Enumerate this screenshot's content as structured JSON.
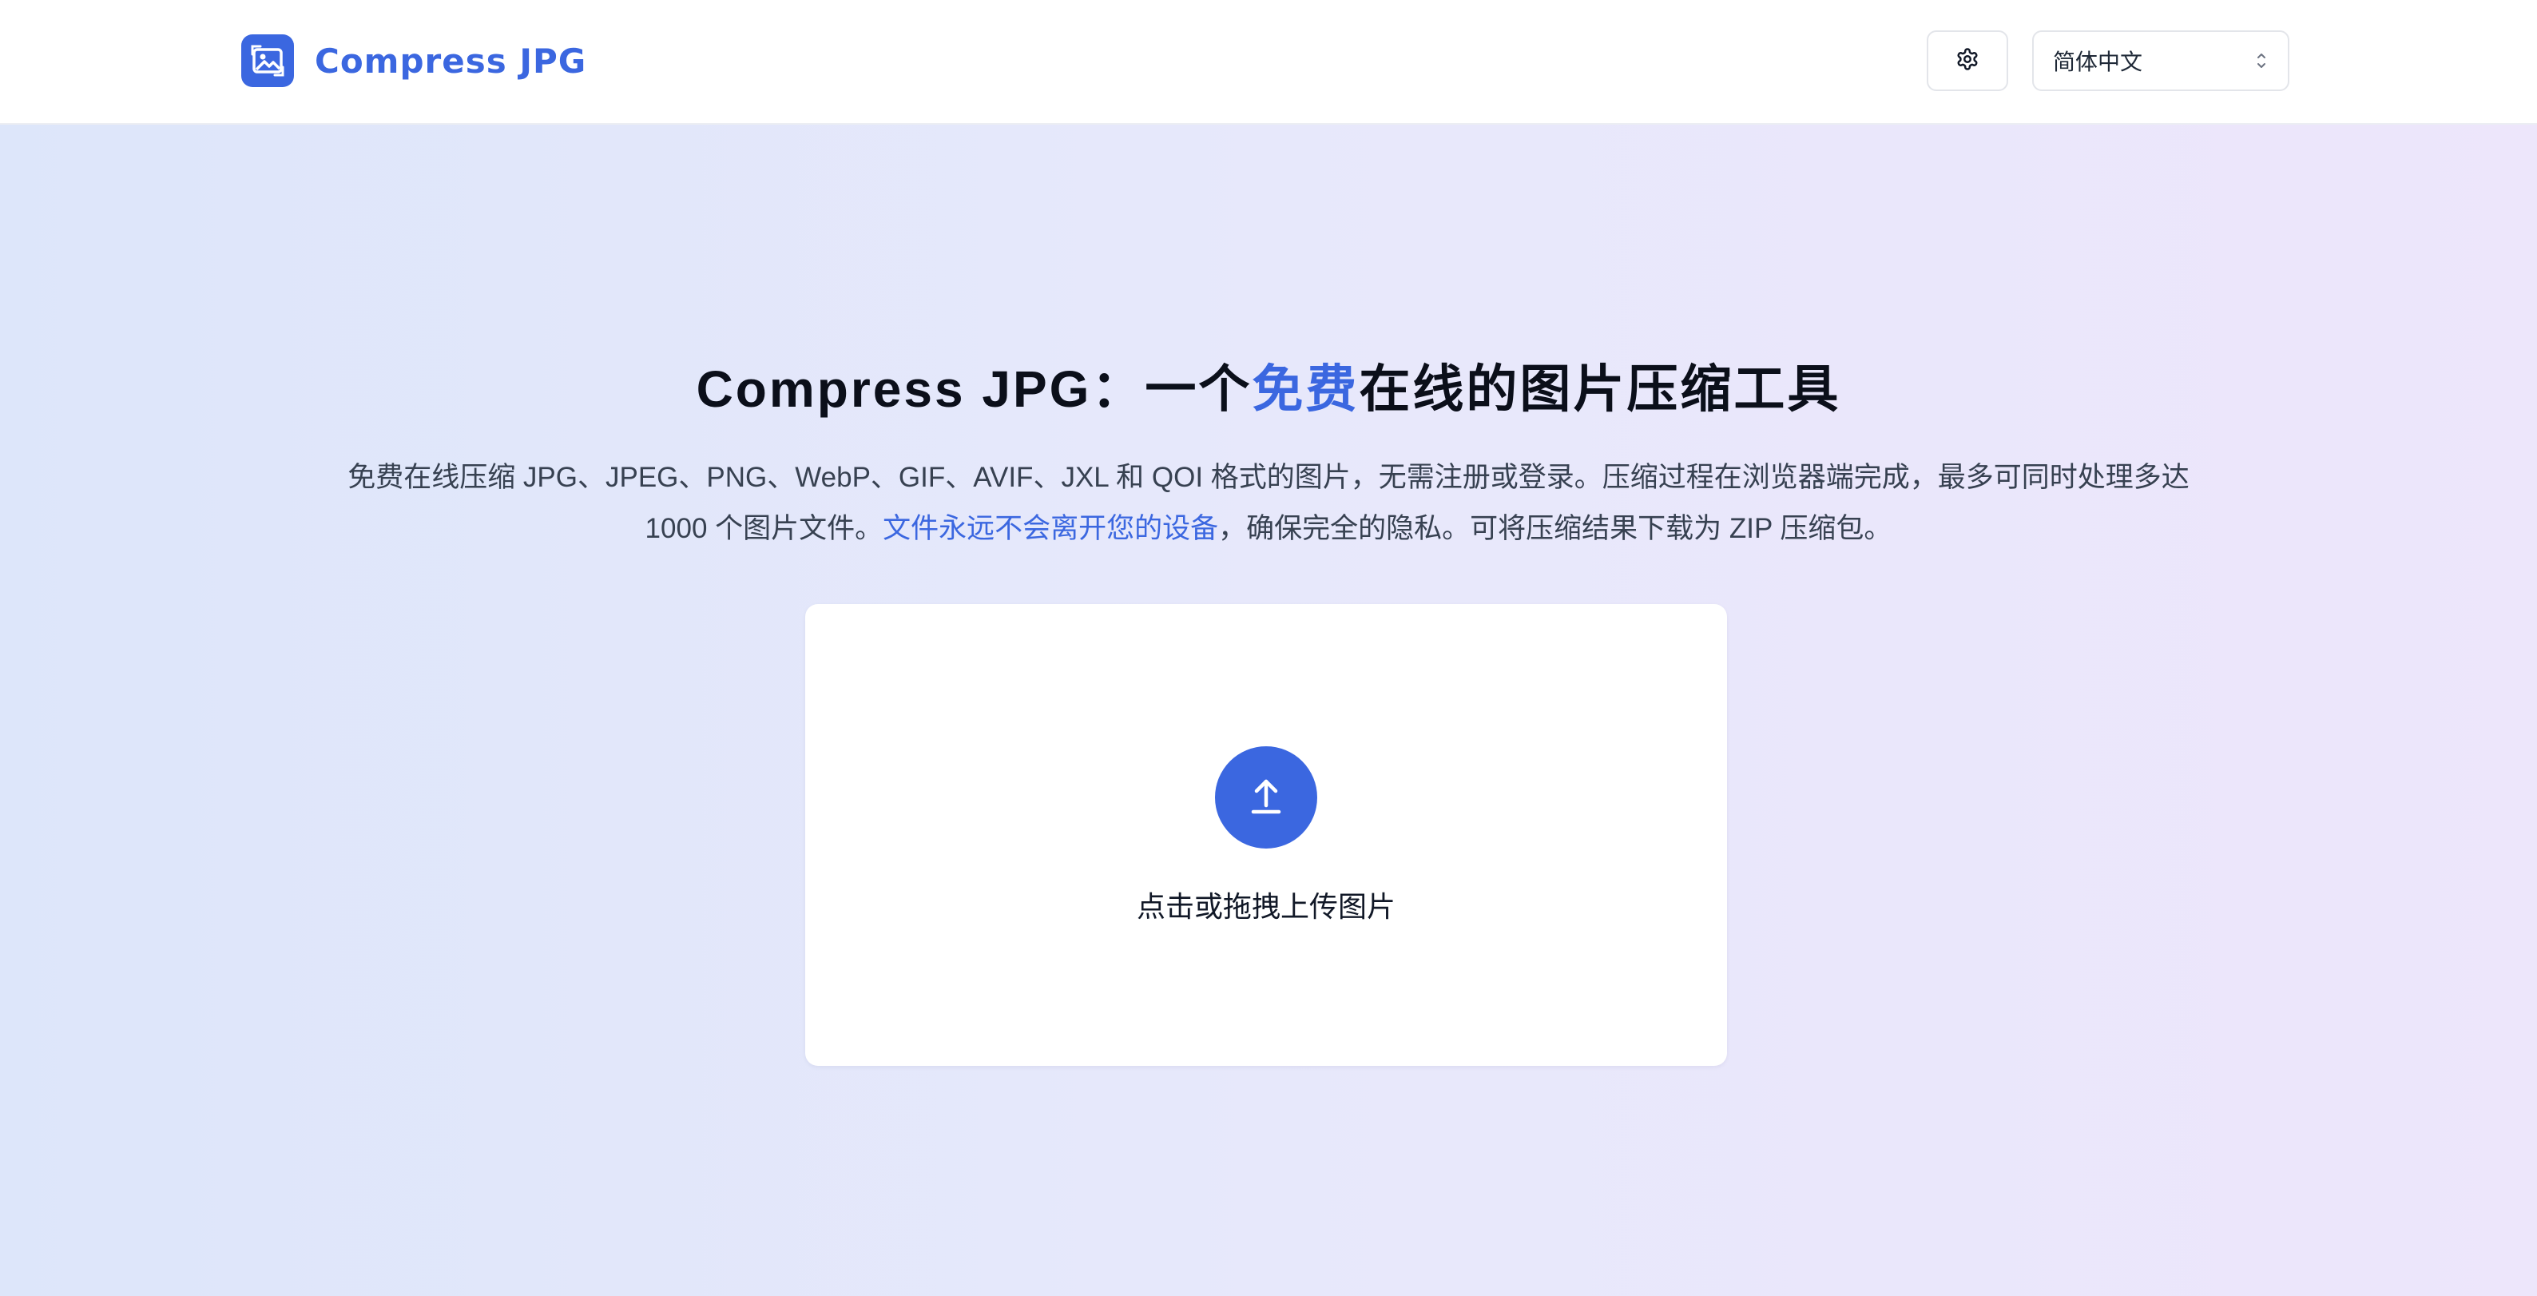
{
  "header": {
    "brand_name": "Compress JPG",
    "logo_icon": "photo-logo-icon",
    "settings_icon": "gear-icon",
    "language": {
      "selected": "简体中文",
      "icon": "chevron-up-down-icon"
    }
  },
  "hero": {
    "title_before": "Compress JPG：一个",
    "title_accent": "免费",
    "title_after": "在线的图片压缩工具",
    "desc_part1": "免费在线压缩 JPG、JPEG、PNG、WebP、GIF、AVIF、JXL 和 QOI 格式的图片，无需注册或登录。压缩过程在浏览器端完成，最多可同时处理多达 1000 个图片文件。",
    "desc_link": "文件永远不会离开您的设备",
    "desc_part2": "，确保完全的隐私。可将压缩结果下载为 ZIP 压缩包。"
  },
  "upload": {
    "icon": "upload-arrow-icon",
    "label": "点击或拖拽上传图片"
  },
  "colors": {
    "accent": "#3b67e0",
    "text": "#111827"
  }
}
